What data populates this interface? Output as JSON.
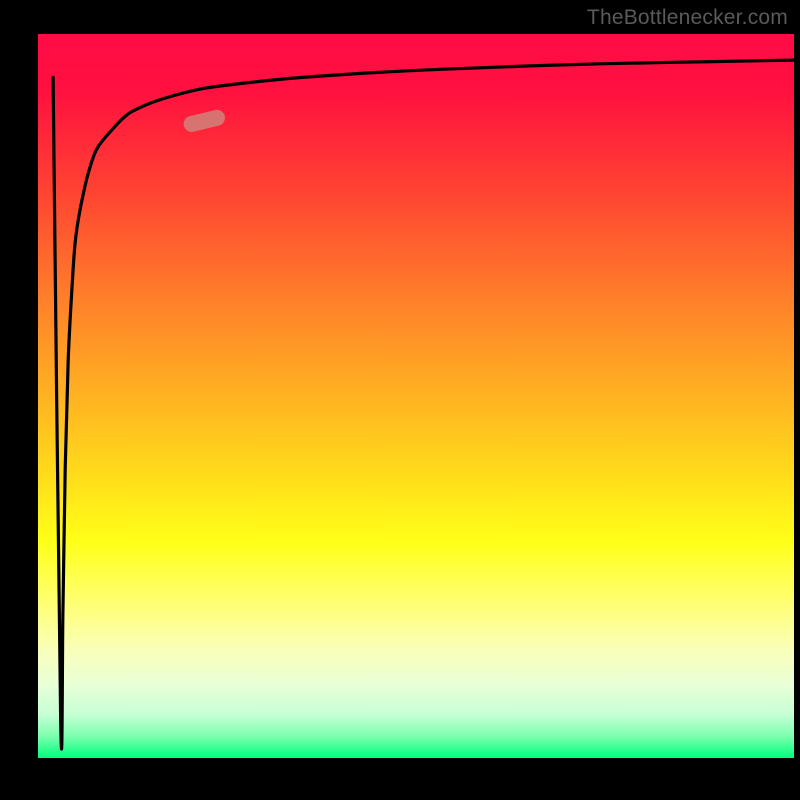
{
  "attribution": "TheBottlenecker.com",
  "colors": {
    "gradient_top": "#ff0b46",
    "gradient_mid": "#ffe01a",
    "gradient_bottom": "#00ff82",
    "curve": "#000000",
    "marker": "#cc8a7f",
    "background": "#000000"
  },
  "chart_data": {
    "type": "line",
    "title": "",
    "xlabel": "",
    "ylabel": "",
    "xlim": [
      0,
      100
    ],
    "ylim": [
      0,
      100
    ],
    "series": [
      {
        "name": "bottleneck-curve",
        "x": [
          2.0,
          3.0,
          3.3,
          3.6,
          4.0,
          4.5,
          5.0,
          6.0,
          7.0,
          8.0,
          10.0,
          12.0,
          15.0,
          18.0,
          22.0,
          28.0,
          35.0,
          45.0,
          55.0,
          65.0,
          75.0,
          85.0,
          95.0,
          100.0
        ],
        "y": [
          94.0,
          5.0,
          20.0,
          40.0,
          55.0,
          65.0,
          72.0,
          78.0,
          82.0,
          84.5,
          87.0,
          89.0,
          90.5,
          91.5,
          92.5,
          93.3,
          94.0,
          94.7,
          95.2,
          95.6,
          95.9,
          96.1,
          96.3,
          96.4
        ]
      }
    ],
    "marker": {
      "x": 22.0,
      "y": 88.0,
      "shape": "pill",
      "color": "#cc8a7f"
    },
    "background_gradient": {
      "direction": "vertical",
      "stops": [
        {
          "pos": 0.0,
          "color": "#ff0b46"
        },
        {
          "pos": 0.5,
          "color": "#ffb222"
        },
        {
          "pos": 0.7,
          "color": "#ffff18"
        },
        {
          "pos": 0.95,
          "color": "#7dffae"
        },
        {
          "pos": 1.0,
          "color": "#00ff82"
        }
      ]
    }
  }
}
